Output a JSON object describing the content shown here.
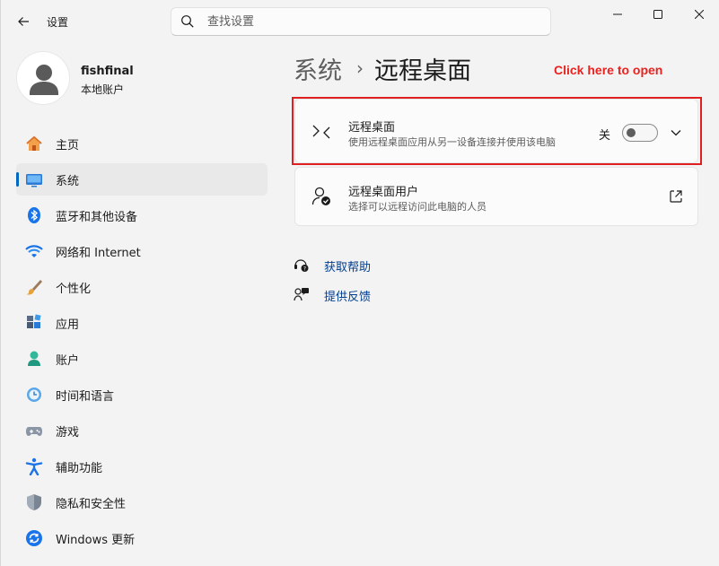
{
  "app": {
    "title": "设置"
  },
  "search": {
    "placeholder": "查找设置"
  },
  "user": {
    "name": "fishfinal",
    "account_type": "本地账户"
  },
  "nav": {
    "items": [
      {
        "label": "主页",
        "icon": "home-icon"
      },
      {
        "label": "系统",
        "icon": "system-icon",
        "active": true
      },
      {
        "label": "蓝牙和其他设备",
        "icon": "bluetooth-icon"
      },
      {
        "label": "网络和 Internet",
        "icon": "wifi-icon"
      },
      {
        "label": "个性化",
        "icon": "brush-icon"
      },
      {
        "label": "应用",
        "icon": "apps-icon"
      },
      {
        "label": "账户",
        "icon": "account-icon"
      },
      {
        "label": "时间和语言",
        "icon": "time-language-icon"
      },
      {
        "label": "游戏",
        "icon": "gamepad-icon"
      },
      {
        "label": "辅助功能",
        "icon": "accessibility-icon"
      },
      {
        "label": "隐私和安全性",
        "icon": "shield-icon"
      },
      {
        "label": "Windows 更新",
        "icon": "windows-update-icon"
      }
    ]
  },
  "breadcrumb": {
    "parent": "系统",
    "separator": "›",
    "current": "远程桌面"
  },
  "annotation": {
    "text": "Click here to open",
    "color": "#e8231f"
  },
  "remote_desktop": {
    "title": "远程桌面",
    "description": "使用远程桌面应用从另一设备连接并使用该电脑",
    "toggle_state": "关",
    "toggle_on": false
  },
  "remote_users": {
    "title": "远程桌面用户",
    "description": "选择可以远程访问此电脑的人员"
  },
  "links": {
    "get_help": "获取帮助",
    "feedback": "提供反馈"
  },
  "colors": {
    "accent": "#0067c0",
    "link": "#003e92",
    "highlight_border": "#e02020"
  }
}
